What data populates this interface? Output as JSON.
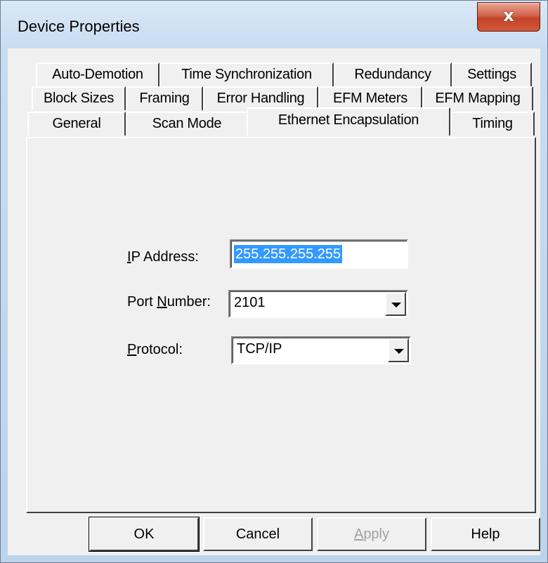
{
  "window": {
    "title": "Device Properties",
    "close_glyph": "x"
  },
  "tabs": {
    "row1": [
      "Auto-Demotion",
      "Time Synchronization",
      "Redundancy",
      "Settings"
    ],
    "row2": [
      "Block Sizes",
      "Framing",
      "Error Handling",
      "EFM Meters",
      "EFM Mapping"
    ],
    "row3": [
      "General",
      "Scan Mode",
      "Ethernet Encapsulation",
      "Timing"
    ],
    "active": "Ethernet Encapsulation"
  },
  "form": {
    "ip_label_first": "I",
    "ip_label_rest": "P Address:",
    "ip_value": "255.255.255.255",
    "port_label_pre": "Port ",
    "port_label_ul": "N",
    "port_label_post": "umber:",
    "port_value": "2101",
    "protocol_label_ul": "P",
    "protocol_label_rest": "rotocol:",
    "protocol_value": "TCP/IP"
  },
  "buttons": {
    "ok": "OK",
    "cancel": "Cancel",
    "apply_ul": "A",
    "apply_rest": "pply",
    "help": "Help"
  },
  "colors": {
    "selection": "#3399ff",
    "close_button": "#c94a30"
  }
}
